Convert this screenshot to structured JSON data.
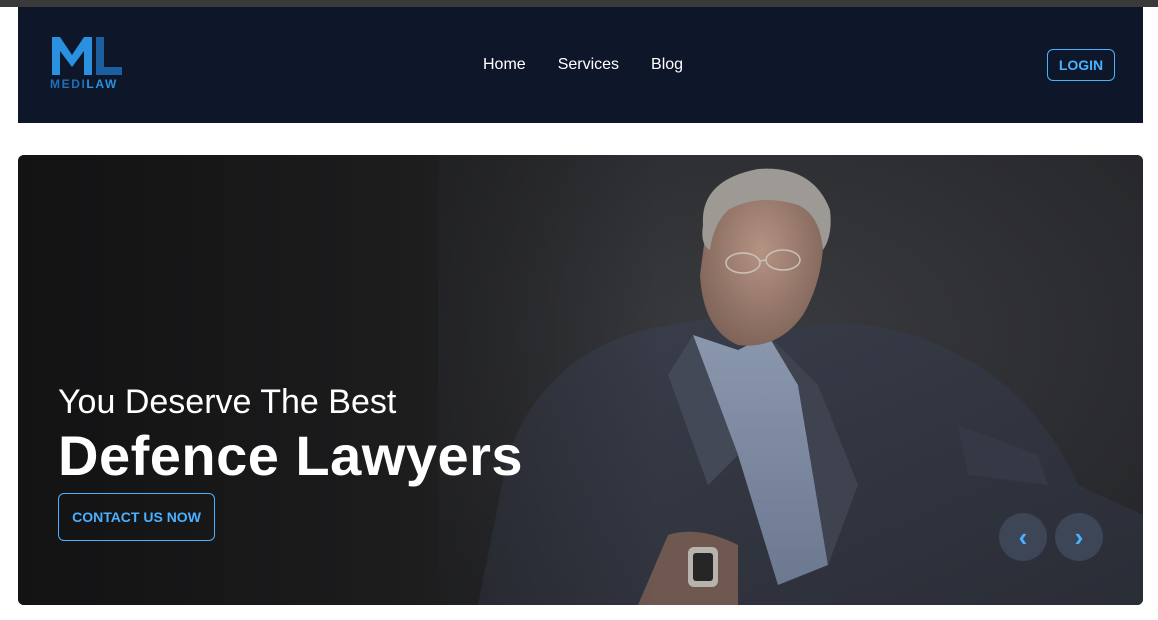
{
  "brand": {
    "logo_monogram": "ML",
    "logo_text_part1": "MEDI",
    "logo_text_part2": "LAW",
    "colors": {
      "navbar_bg": "#0e1729",
      "accent": "#4ab0ff",
      "logo_dark": "#1f6fb8",
      "logo_light": "#2a90e0"
    }
  },
  "nav": {
    "links": [
      "Home",
      "Services",
      "Blog"
    ],
    "login_label": "LOGIN"
  },
  "hero": {
    "subtitle": "You Deserve The Best",
    "title": "Defence Lawyers",
    "cta_label": "CONTACT US NOW",
    "prev_icon": "chevron-left-icon",
    "next_icon": "chevron-right-icon",
    "prev_glyph": "‹",
    "next_glyph": "›"
  }
}
